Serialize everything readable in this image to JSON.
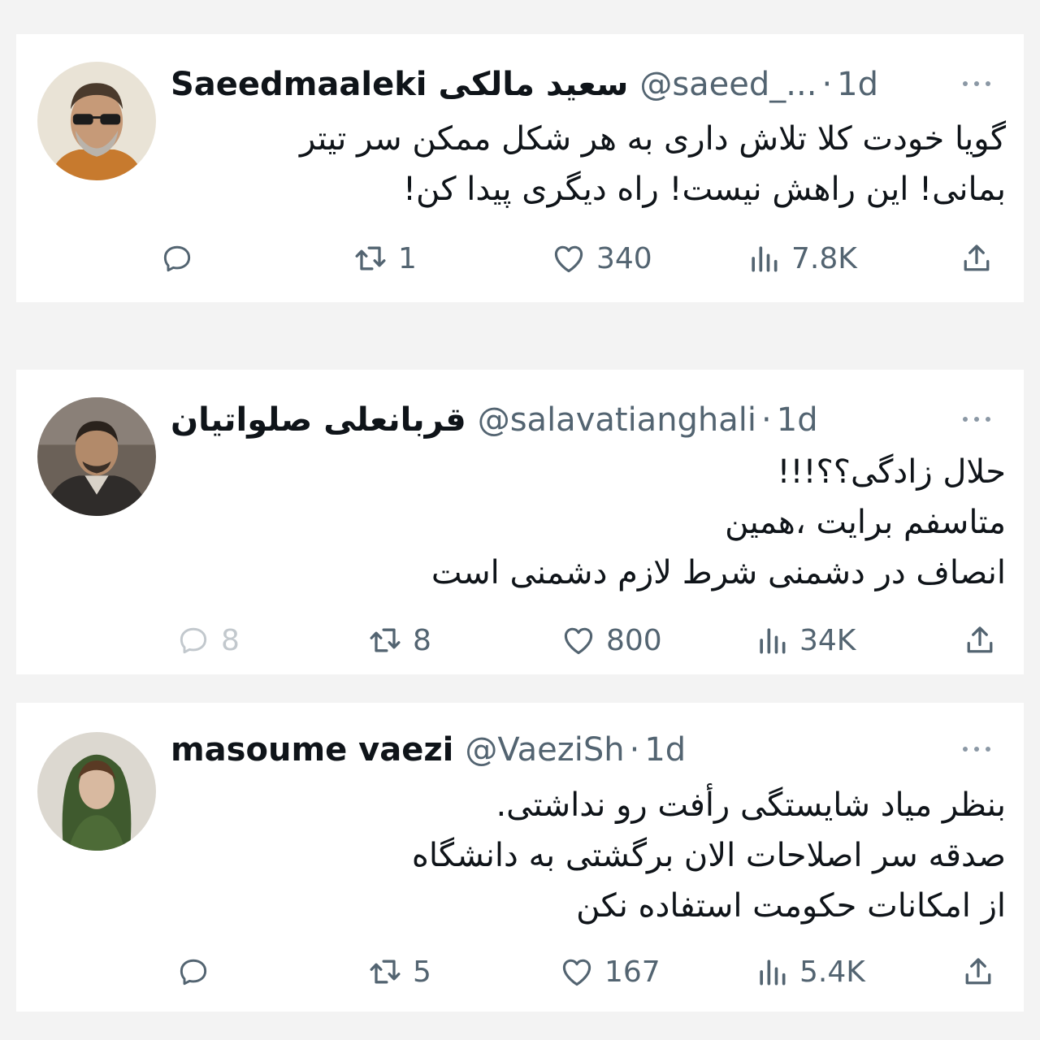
{
  "tweets": [
    {
      "author_name": "Saeedmaaleki",
      "author_name_fa": "سعید مالکی",
      "handle": "@saeed_...",
      "separator": "·",
      "time": "1d",
      "text_lines": [
        "گویا خودت کلا تلاش داری به هر شکل ممکن سر تیتر",
        "بمانی! این راهش نیست! راه دیگری پیدا کن!"
      ],
      "reply_count": "",
      "retweet_count": "1",
      "like_count": "340",
      "view_count": "7.8K"
    },
    {
      "author_name": "",
      "author_name_fa": "قربانعلی صلواتیان",
      "handle": "@salavatianghali",
      "separator": "·",
      "time": "1d",
      "text_lines": [
        "حلال زادگی؟؟!!!",
        "متاسفم برایت ،همین",
        "انصاف در دشمنی شرط لازم دشمنی است"
      ],
      "reply_count": "8",
      "retweet_count": "8",
      "like_count": "800",
      "view_count": "34K"
    },
    {
      "author_name": "masoume vaezi",
      "author_name_fa": "",
      "handle": "@VaeziSh",
      "separator": "·",
      "time": "1d",
      "text_lines": [
        "بنظر میاد شایستگی رأفت رو نداشتی.",
        "صدقه سر اصلاحات الان برگشتی به دانشگاه",
        "از امکانات حکومت استفاده نکن"
      ],
      "reply_count": "",
      "retweet_count": "5",
      "like_count": "167",
      "view_count": "5.4K"
    }
  ],
  "icons": {
    "reply": "reply-icon",
    "retweet": "retweet-icon",
    "like": "heart-icon",
    "views": "views-icon",
    "share": "share-icon",
    "more": "more-icon"
  },
  "colors": {
    "text": "#0f1419",
    "secondary": "#536471",
    "card": "#ffffff",
    "background": "#f3f3f3"
  }
}
